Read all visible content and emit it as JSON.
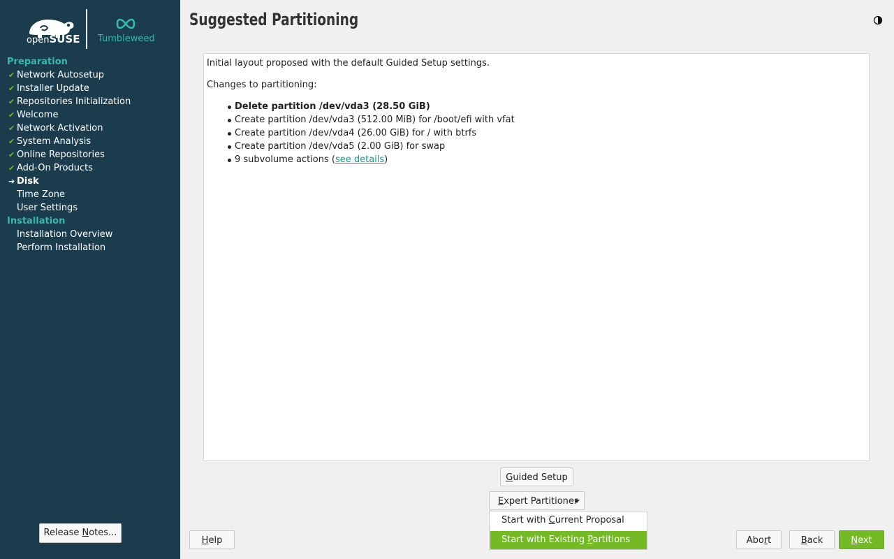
{
  "brand": {
    "suse_prefix": "open",
    "suse_name": "SUSE",
    "product": "Tumbleweed"
  },
  "sidebar": {
    "groups": [
      {
        "label": "Preparation"
      },
      {
        "label": "Installation"
      }
    ],
    "items": [
      {
        "label": "Network Autosetup",
        "state": "done"
      },
      {
        "label": "Installer Update",
        "state": "done"
      },
      {
        "label": "Repositories Initialization",
        "state": "done"
      },
      {
        "label": "Welcome",
        "state": "done"
      },
      {
        "label": "Network Activation",
        "state": "done"
      },
      {
        "label": "System Analysis",
        "state": "done"
      },
      {
        "label": "Online Repositories",
        "state": "done"
      },
      {
        "label": "Add-On Products",
        "state": "done"
      },
      {
        "label": "Disk",
        "state": "current"
      },
      {
        "label": "Time Zone",
        "state": "pending"
      },
      {
        "label": "User Settings",
        "state": "pending"
      },
      {
        "label": "Installation Overview",
        "state": "pending"
      },
      {
        "label": "Perform Installation",
        "state": "pending"
      }
    ],
    "release_notes_label": "Release Notes...",
    "release_notes_mnemonic": "N"
  },
  "header": {
    "title": "Suggested Partitioning",
    "theme_icon": "half-moon-icon"
  },
  "content": {
    "intro": "Initial layout proposed with the default Guided Setup settings.",
    "changes_heading": "Changes to partitioning:",
    "changes": [
      "Delete partition /dev/vda3 (28.50 GiB)",
      "Create partition /dev/vda3 (512.00 MiB) for /boot/efi with vfat",
      "Create partition /dev/vda4 (26.00 GiB) for / with btrfs",
      "Create partition /dev/vda5 (2.00 GiB) for swap"
    ],
    "subvolume_prefix": "9 subvolume actions (",
    "subvolume_link": "see details",
    "subvolume_suffix": ")"
  },
  "buttons": {
    "guided_setup": {
      "mnemonic": "G",
      "rest": "uided Setup"
    },
    "expert_partitioner": {
      "mnemonic": "E",
      "rest": "xpert Partitioner"
    },
    "help": {
      "mnemonic": "H",
      "rest": "elp"
    },
    "abort_pre": "Abo",
    "abort_mnemonic": "r",
    "abort_post": "t",
    "back": {
      "mnemonic": "B",
      "rest": "ack"
    },
    "next": {
      "mnemonic": "N",
      "rest": "ext"
    }
  },
  "menu": {
    "items": [
      {
        "pre": "Start with ",
        "mnemonic": "C",
        "post": "urrent Proposal"
      },
      {
        "pre": "Start with Existing ",
        "mnemonic": "P",
        "post": "artitions",
        "highlighted": true
      }
    ]
  },
  "colors": {
    "sidebar_bg": "#1a3c4d",
    "accent_green": "#73ba25",
    "accent_teal": "#35b9ab",
    "link": "#0f9e8a"
  }
}
